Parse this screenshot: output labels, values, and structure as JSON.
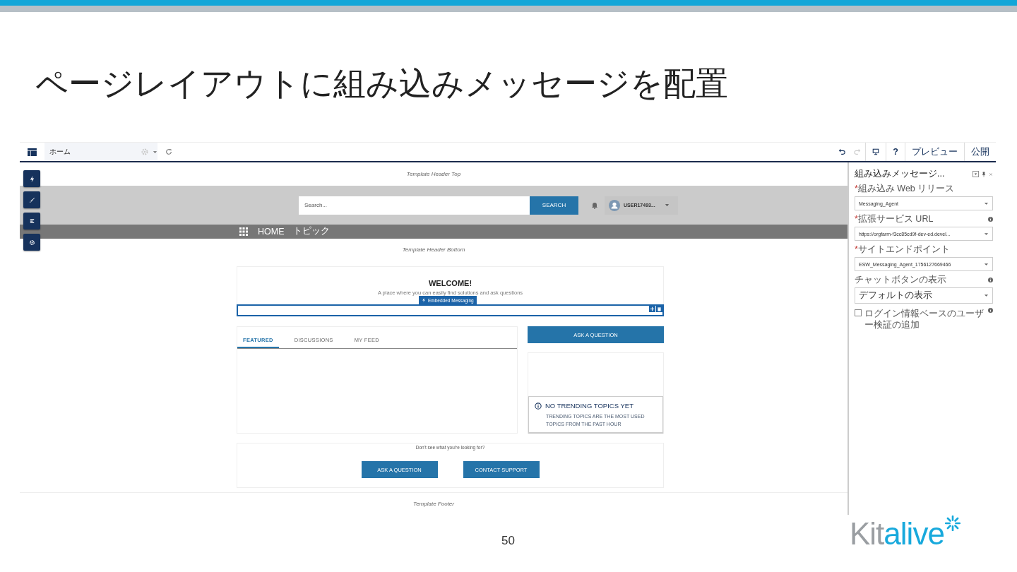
{
  "slide": {
    "title": "ページレイアウトに組み込みメッセージを配置",
    "page_number": "50",
    "logo": {
      "part_1": "Kit",
      "part_2": "alive"
    }
  },
  "builder": {
    "toolbar": {
      "page": "ホーム",
      "help": "?",
      "buttons": [
        "プレビュー",
        "公開"
      ]
    },
    "canvas": {
      "header_top": "Template Header Top",
      "search": {
        "placeholder": "Search...",
        "button": "SEARCH"
      },
      "user": "USER17493...",
      "nav": [
        "HOME",
        "トピック"
      ],
      "header_bottom": "Template Header Bottom",
      "welcome": {
        "title": "WELCOME!",
        "subtitle": "A place where you can easily find solutions and ask questions"
      },
      "component_label": "Embedded Messaging",
      "tabs": [
        {
          "label": "FEATURED",
          "selected": true
        },
        {
          "label": "DISCUSSIONS",
          "selected": false
        },
        {
          "label": "MY FEED",
          "selected": false
        }
      ],
      "ask_button": "ASK A QUESTION",
      "trending": {
        "title": "NO TRENDING TOPICS YET",
        "text": "TRENDING TOPICS ARE THE MOST USED TOPICS FROM THE PAST HOUR"
      },
      "help": {
        "text": "Don't see what you're looking for?",
        "buttons": [
          "ASK A QUESTION",
          "CONTACT SUPPORT"
        ]
      },
      "footer": "Template Footer"
    },
    "panel": {
      "title": "組み込みメッセージ...",
      "fields": [
        {
          "kind": "select",
          "required_mark": "*",
          "label": "組み込み Web リリース",
          "info": false,
          "value": "Messaging_Agent"
        },
        {
          "kind": "select",
          "required_mark": "*",
          "label": "拡張サービス URL",
          "info": true,
          "value": "https://orgfarm-f3cc85cd9f-dev-ed.devel..."
        },
        {
          "kind": "select",
          "required_mark": "*",
          "label": "サイトエンドポイント",
          "info": false,
          "value": "ESW_Messaging_Agent_1756127669466"
        },
        {
          "kind": "select",
          "label": "チャットボタンの表示",
          "info": true,
          "value": "デフォルトの表示"
        },
        {
          "kind": "checkbox",
          "label": "ログイン情報ベースのユーザー検証の追加",
          "info": true,
          "checked": false
        }
      ]
    }
  }
}
